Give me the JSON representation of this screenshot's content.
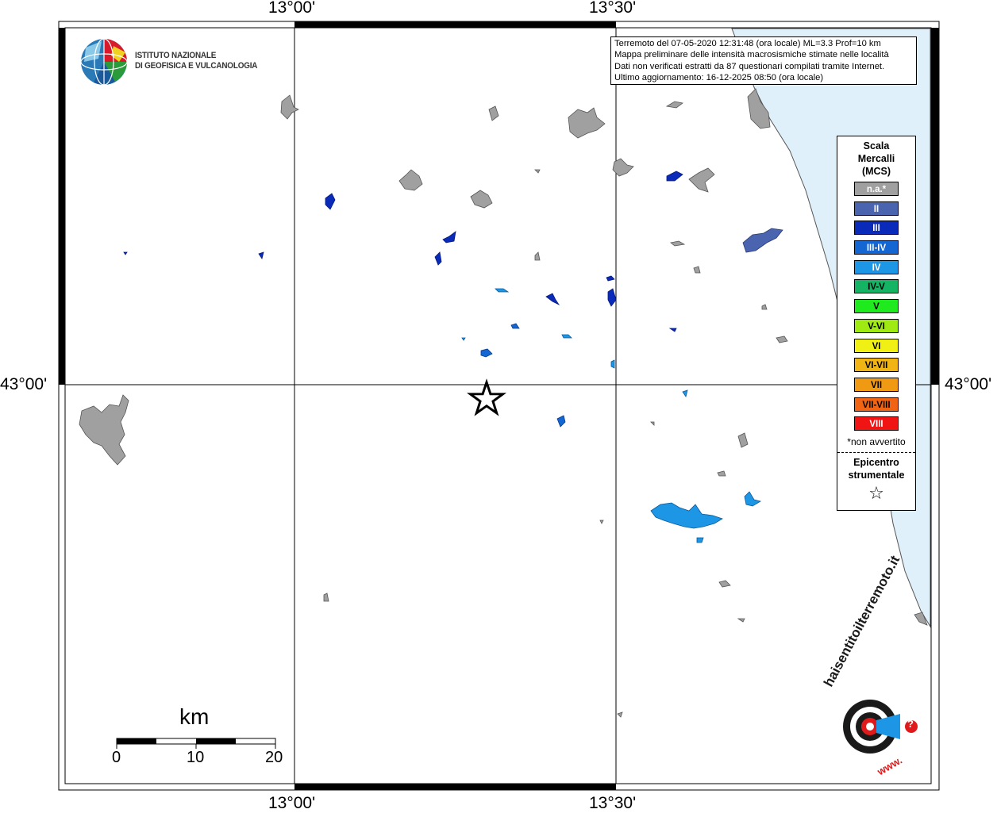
{
  "coords": {
    "top_left": "13°00'",
    "top_right": "13°30'",
    "bottom_left": "13°00'",
    "bottom_right": "13°30'",
    "left_lat": "43°00'",
    "right_lat": "43°00'"
  },
  "logo": {
    "line1": "ISTITUTO NAZIONALE",
    "line2": "DI GEOFISICA E VULCANOLOGIA"
  },
  "info": {
    "line1": "Terremoto del 07-05-2020 12:31:48 (ora locale) ML=3.3 Prof=10 km",
    "line2": "Mappa preliminare delle intensità macrosismiche stimate nelle località",
    "line3": "Dati non verificati estratti da 87 questionari compilati tramite Internet.",
    "line4": "Ultimo aggiornamento: 16-12-2025 08:50 (ora locale)"
  },
  "legend": {
    "title1": "Scala",
    "title2": "Mercalli",
    "title3": "(MCS)",
    "items": [
      {
        "label": "n.a.*",
        "color": "#a0a0a0",
        "text": "#ffffff"
      },
      {
        "label": "II",
        "color": "#4a64b0",
        "text": "#ffffff"
      },
      {
        "label": "III",
        "color": "#0a2aba",
        "text": "#ffffff"
      },
      {
        "label": "III-IV",
        "color": "#1466d2",
        "text": "#ffffff"
      },
      {
        "label": "IV",
        "color": "#1e96e6",
        "text": "#ffffff"
      },
      {
        "label": "IV-V",
        "color": "#14b464",
        "text": "#000000"
      },
      {
        "label": "V",
        "color": "#1eea1e",
        "text": "#000000"
      },
      {
        "label": "V-VI",
        "color": "#a0ea14",
        "text": "#000000"
      },
      {
        "label": "VI",
        "color": "#f0f014",
        "text": "#000000"
      },
      {
        "label": "VI-VII",
        "color": "#f0b414",
        "text": "#000000"
      },
      {
        "label": "VII",
        "color": "#f09a14",
        "text": "#000000"
      },
      {
        "label": "VII-VIII",
        "color": "#f06414",
        "text": "#000000"
      },
      {
        "label": "VIII",
        "color": "#f01414",
        "text": "#ffffff"
      }
    ],
    "footnote": "*non avvertito",
    "epi1": "Epicentro",
    "epi2": "strumentale",
    "star": "☆"
  },
  "scale": {
    "title": "km",
    "ticks": [
      "0",
      "10",
      "20"
    ]
  },
  "brand": {
    "name": "haisentitoilterremoto.it",
    "www": "www.",
    "q": "?"
  },
  "colors": {
    "sea": "#dff0fa",
    "na": "#a0a0a0",
    "ii": "#4a64b0",
    "iii": "#0a2aba",
    "iii_iv": "#1466d2",
    "iv": "#1e96e6"
  }
}
